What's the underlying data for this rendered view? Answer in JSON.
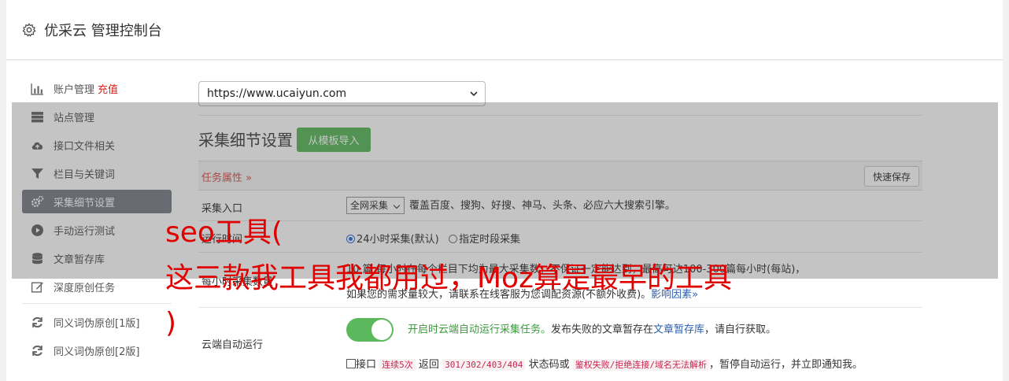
{
  "header": {
    "title": "优采云 管理控制台"
  },
  "sidebar": {
    "items": [
      {
        "label": "账户管理",
        "badge": "充值"
      },
      {
        "label": "站点管理"
      },
      {
        "label": "接口文件相关"
      },
      {
        "label": "栏目与关键词"
      },
      {
        "label": "采集细节设置"
      },
      {
        "label": "手动运行测试"
      },
      {
        "label": "文章暂存库"
      },
      {
        "label": "深度原创任务"
      },
      {
        "label": "同义词伪原创[1版]"
      },
      {
        "label": "同义词伪原创[2版]"
      }
    ]
  },
  "site_select": {
    "value": "https://www.ucaiyun.com"
  },
  "main": {
    "section_title": "采集细节设置",
    "import_button": "从模板导入",
    "task_label": "任务属性 »",
    "save_button": "快速保存",
    "entry": {
      "label": "采集入口",
      "select_value": "全网采集",
      "desc": "覆盖百度、搜狗、好搜、神马、头条、必应六大搜索引擎。"
    },
    "time": {
      "label": "运行时间",
      "option1": "24小时采集(默认)",
      "option2": "指定时段采集"
    },
    "limit": {
      "label": "每小时采集数量",
      "line1": "10   篇  每小时在每个栏目下均为最大采集数，不保证一定能达到，最高可达100-300篇每小时(每站)，",
      "line2": "如果您的需求量较大，请联系在线客服为您调配资源(不额外收费)。",
      "link": "影响因素"
    },
    "cloud": {
      "label": "云端自动运行",
      "desc_green": "开启时云端自动运行采集任务。",
      "desc_mid": "发布失败的文章暂存在",
      "desc_link": "文章暂存库",
      "desc_end": "，请自行获取。",
      "check_text1": "接口",
      "code1": "连续5次",
      "check_text2": "返回",
      "code2": "301/302/403/404",
      "check_text3": "状态码或",
      "code3": "鉴权失败/拒绝连接/域名无法解析",
      "check_text4": "，暂停自动运行，并立即通知我。"
    }
  },
  "overlay_text": {
    "line1": "seo工具(",
    "line2": "这三款我工具我都用过，Moz算是最早的工具",
    "line3": ")"
  },
  "colors": {
    "accent_green": "#5cb85c",
    "active_item": "#7b808a",
    "badge_red": "#d9231b",
    "overlay_red": "#e00000"
  }
}
